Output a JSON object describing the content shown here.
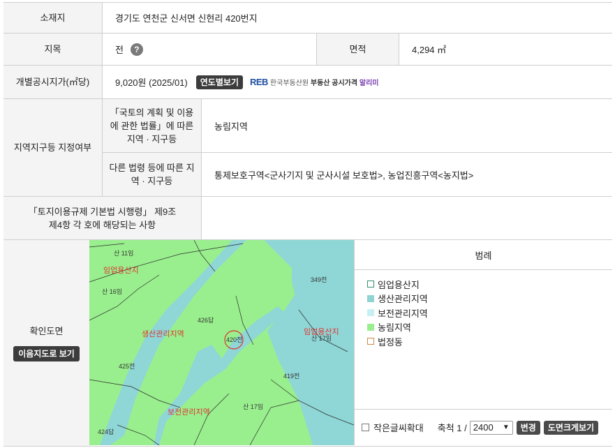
{
  "location": {
    "label": "소재지",
    "value": "경기도 연천군 신서면 신현리 420번지"
  },
  "land_category": {
    "label": "지목",
    "value": "전",
    "help": "?",
    "area_label": "면적",
    "area_value": "4,294 ㎡"
  },
  "official_price": {
    "label": "개별공시지가(㎡당)",
    "value": "9,020원 (2025/01)",
    "button": "연도별보기",
    "logo_mark": "REB",
    "logo_org": "한국부동산원",
    "logo_service": "부동산 공시가격",
    "logo_app": "알리미"
  },
  "zoning": {
    "label": "지역지구등 지정여부",
    "law1_label": "「국토의 계획 및 이용에 관한 법률」에 따른 지역 · 지구등",
    "law1_value": "농림지역",
    "law2_label": "다른 법령 등에 따른 지역 · 지구등",
    "law2_value": "통제보호구역<군사기지 및 군사시설 보호법>, 농업진흥구역<농지법>"
  },
  "enforcement": {
    "label": "「토지이용규제 기본법 시행령」 제9조 제4항 각 호에 해당되는 사항",
    "value": ""
  },
  "map": {
    "label": "확인도면",
    "button": "이음지도로 보기",
    "labels": {
      "mountain_11": "산 11임",
      "forest_left": "임업용산지",
      "mountain_16": "산 16임",
      "parcel_426": "426답",
      "production_zone": "생산관리지역",
      "parcel_420": "420전",
      "parcel_425": "425전",
      "parcel_419": "419전",
      "parcel_349": "349전",
      "forest_right": "임업용산지",
      "mountain_17_right": "산 17임",
      "conservation_zone": "보전관리지역",
      "mountain_17_bottom": "산 17임",
      "parcel_424": "424답"
    }
  },
  "legend": {
    "title": "범례",
    "items": [
      {
        "label": "임업용산지",
        "color": "#ffffff",
        "border": "#2e8f6e"
      },
      {
        "label": "생산관리지역",
        "color": "#8fd3d3",
        "border": "#8fd3d3"
      },
      {
        "label": "보전관리지역",
        "color": "#c8f0f4",
        "border": "#c8f0f4"
      },
      {
        "label": "농림지역",
        "color": "#99ef8e",
        "border": "#99ef8e"
      },
      {
        "label": "법정동",
        "color": "#ffffff",
        "border": "#c98a4a"
      }
    ],
    "enlarge_label": "작은글씨확대",
    "scale_label": "축척 1 /",
    "scale_value": "2400",
    "change_button": "변경",
    "zoom_button": "도면크게보기"
  },
  "colors": {
    "agri": "#99ef8e",
    "production": "#8fd6d6",
    "red": "#e0322f"
  }
}
